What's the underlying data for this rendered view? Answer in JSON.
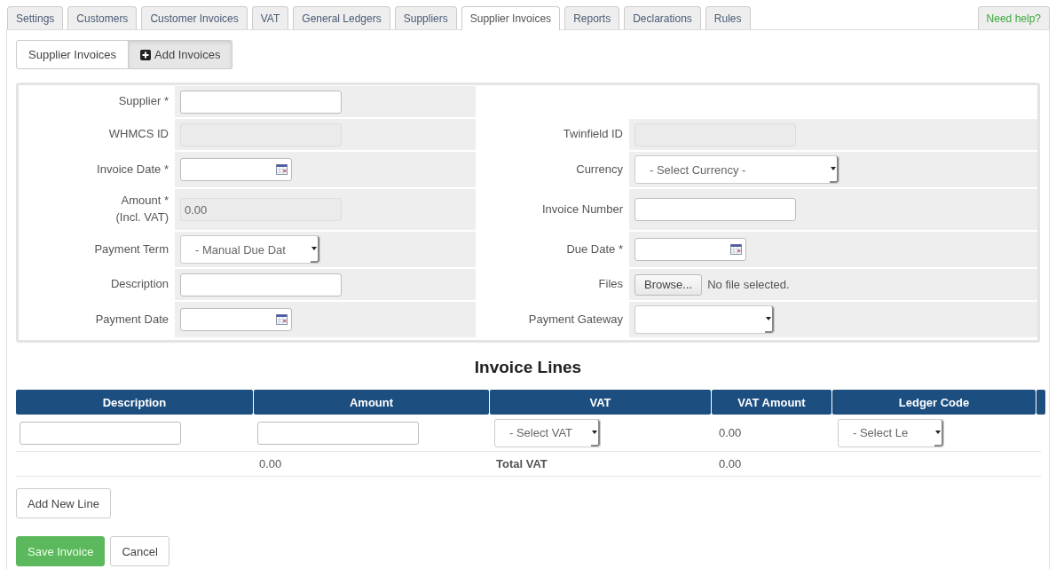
{
  "tabs": [
    {
      "label": "Settings",
      "selected": false
    },
    {
      "label": "Customers",
      "selected": false
    },
    {
      "label": "Customer Invoices",
      "selected": false
    },
    {
      "label": "VAT",
      "selected": false
    },
    {
      "label": "General Ledgers",
      "selected": false
    },
    {
      "label": "Suppliers",
      "selected": false
    },
    {
      "label": "Supplier Invoices",
      "selected": true
    },
    {
      "label": "Reports",
      "selected": false
    },
    {
      "label": "Declarations",
      "selected": false
    },
    {
      "label": "Rules",
      "selected": false
    }
  ],
  "help_link": "Need help?",
  "subtabs": [
    {
      "label": "Supplier Invoices",
      "selected": false,
      "kind": "plain"
    },
    {
      "label": "Add Invoices",
      "selected": true,
      "kind": "add"
    }
  ],
  "form": {
    "rows": [
      {
        "left": {
          "label": "Supplier *",
          "kind": "text"
        }
      },
      {
        "left": {
          "label": "WHMCS ID",
          "kind": "readonly"
        },
        "right": {
          "label": "Twinfield ID",
          "kind": "readonly"
        }
      },
      {
        "left": {
          "label": "Invoice Date *",
          "kind": "date"
        },
        "right": {
          "label": "Currency",
          "kind": "select",
          "value": "- Select Currency -"
        }
      },
      {
        "left": {
          "label": "Amount *",
          "sublabel": "(Incl. VAT)",
          "kind": "readonly",
          "value": "0.00"
        },
        "right": {
          "label": "Invoice Number",
          "kind": "text"
        }
      },
      {
        "left": {
          "label": "Payment Term",
          "kind": "select",
          "value": "- Manual Due Dat"
        },
        "right": {
          "label": "Due Date *",
          "kind": "date"
        }
      },
      {
        "left": {
          "label": "Description",
          "kind": "text"
        },
        "right": {
          "label": "Files",
          "kind": "file",
          "button": "Browse...",
          "status": "No file selected."
        }
      },
      {
        "left": {
          "label": "Payment Date",
          "kind": "date"
        },
        "right": {
          "label": "Payment Gateway",
          "kind": "select"
        }
      }
    ]
  },
  "invoice_lines": {
    "title": "Invoice Lines",
    "columns": [
      {
        "kind": "label",
        "label": "Description"
      },
      {
        "kind": "label",
        "label": "Amount"
      },
      {
        "kind": "label",
        "label": "VAT"
      },
      {
        "kind": "label",
        "label": "VAT Amount"
      },
      {
        "kind": "label",
        "label": "Ledger Code"
      },
      {
        "kind": "blank"
      }
    ],
    "rows": [
      {
        "kind": "line",
        "cells": [
          {
            "kind": "input"
          },
          {
            "kind": "input"
          },
          {
            "kind": "select",
            "value": "- Select VAT"
          },
          {
            "kind": "text",
            "value": "0.00"
          },
          {
            "kind": "select",
            "value": "- Select Le"
          }
        ]
      },
      {
        "kind": "total",
        "cells": [
          {
            "kind": "empty"
          },
          {
            "kind": "text",
            "value": "0.00"
          },
          {
            "kind": "bold",
            "value": "Total VAT"
          },
          {
            "kind": "text",
            "value": "0.00"
          },
          {
            "kind": "empty"
          }
        ]
      }
    ]
  },
  "add_line_button": "Add New Line",
  "actions": [
    {
      "label": "Save Invoice",
      "kind": "primary"
    },
    {
      "label": "Cancel",
      "kind": "default"
    }
  ]
}
